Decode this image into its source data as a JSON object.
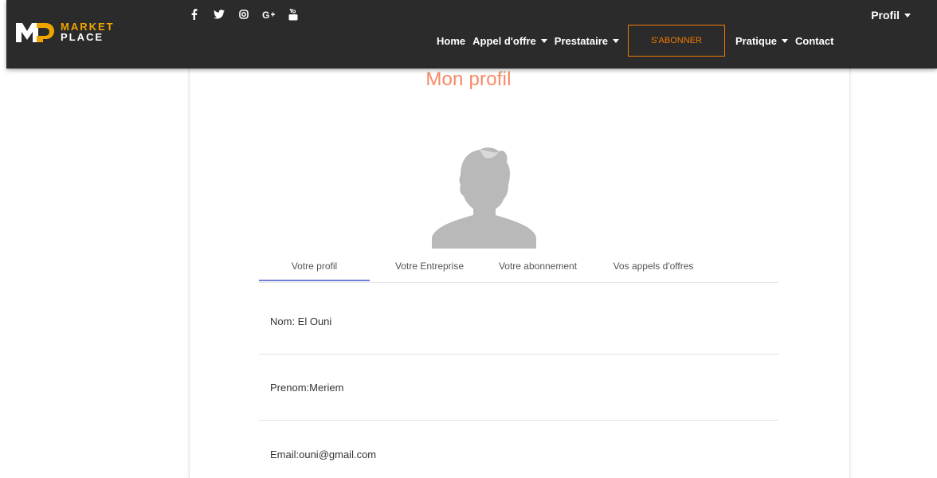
{
  "brand": {
    "line1": "MARKET",
    "line2": "PLACE",
    "accent_color": "#f0a400"
  },
  "social": [
    "facebook-icon",
    "twitter-icon",
    "instagram-icon",
    "google-plus-icon",
    "youtube-icon"
  ],
  "top_menu": {
    "profil_label": "Profil"
  },
  "nav": {
    "home": "Home",
    "appel": "Appel d'offre",
    "prestataire": "Prestataire",
    "subscribe": "S'ABONNER",
    "pratique": "Pratique",
    "contact": "Contact",
    "subscribe_color": "#f07800"
  },
  "page": {
    "title": "Mon profil",
    "title_color": "#f58a67"
  },
  "tabs": [
    {
      "label": "Votre profil",
      "active": true
    },
    {
      "label": "Votre Entreprise",
      "active": false
    },
    {
      "label": "Votre abonnement",
      "active": false
    },
    {
      "label": "Vos appels d'offres",
      "active": false
    }
  ],
  "profile": {
    "nom": "Nom: El Ouni",
    "prenom": "Prenom:Meriem",
    "email": "Email:ouni@gmail.com"
  }
}
